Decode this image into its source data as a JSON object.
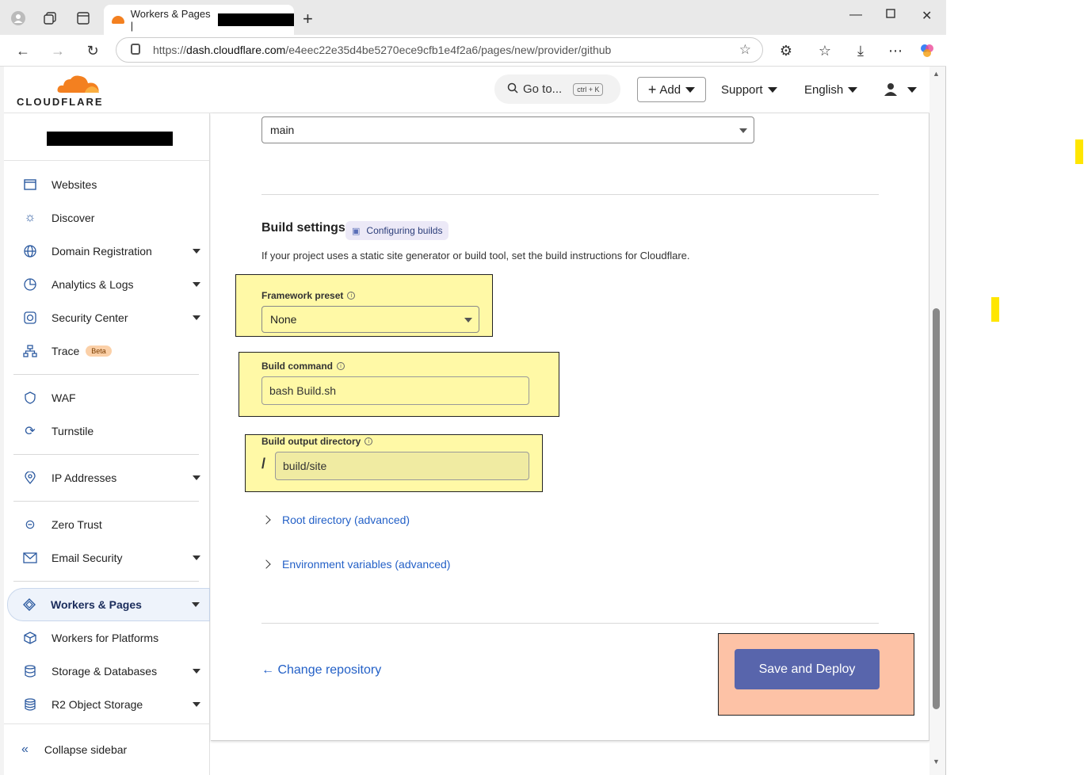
{
  "browser": {
    "tab_title": "Workers & Pages |",
    "url_prefix": "https://",
    "url_host": "dash.cloudflare.com",
    "url_path": "/e4eec22e35d4be5270ece9cfb1e4f2a6/pages/new/provider/github"
  },
  "header": {
    "logo_text": "CLOUDFLARE",
    "goto_label": "Go to...",
    "goto_shortcut": "ctrl + K",
    "add_label": "Add",
    "support_label": "Support",
    "language_label": "English"
  },
  "sidebar": {
    "items": [
      {
        "label": "Websites"
      },
      {
        "label": "Discover"
      },
      {
        "label": "Domain Registration"
      },
      {
        "label": "Analytics & Logs"
      },
      {
        "label": "Security Center"
      },
      {
        "label": "Trace",
        "badge": "Beta"
      },
      {
        "label": "WAF"
      },
      {
        "label": "Turnstile"
      },
      {
        "label": "IP Addresses"
      },
      {
        "label": "Zero Trust"
      },
      {
        "label": "Email Security"
      },
      {
        "label": "Workers & Pages"
      },
      {
        "label": "Workers for Platforms"
      },
      {
        "label": "Storage & Databases"
      },
      {
        "label": "R2 Object Storage"
      }
    ],
    "collapse_label": "Collapse sidebar"
  },
  "form": {
    "branch_value": "main",
    "section_title": "Build settings",
    "docs_link": "Configuring builds",
    "description": "If your project uses a static site generator or build tool, set the build instructions for Cloudflare.",
    "framework_label": "Framework preset",
    "framework_value": "None",
    "build_command_label": "Build command",
    "build_command_value": "bash Build.sh",
    "output_dir_label": "Build output directory",
    "output_dir_prefix": "/",
    "output_dir_value": "build/site",
    "root_dir_link": "Root directory (advanced)",
    "env_vars_link": "Environment variables (advanced)",
    "change_repo": "← Change repository",
    "deploy_button": "Save and Deploy"
  },
  "colors": {
    "brand_orange": "#f38020",
    "primary_button": "#5865ac",
    "link": "#2360c7",
    "highlight_yellow": "#fff9a6",
    "highlight_salmon": "#fdc2a6"
  }
}
